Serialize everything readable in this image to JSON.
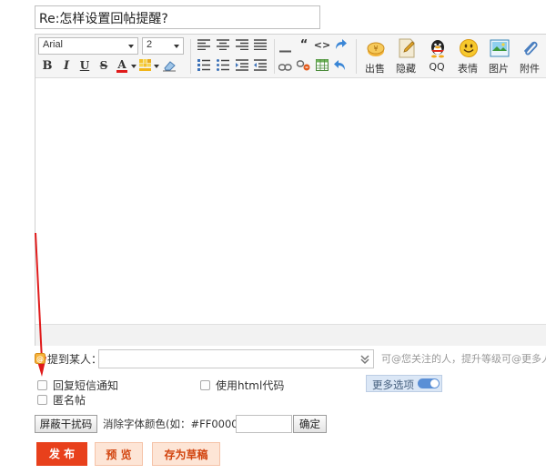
{
  "title_value": "Re:怎样设置回帖提醒?",
  "toolbar": {
    "font_family": "Arial",
    "font_size": "2",
    "bold": "B",
    "italic": "I",
    "underline": "U",
    "strike": "S",
    "text_color_glyph": "A",
    "quote_glyph": "“",
    "code_glyph": "<>",
    "buttons": [
      {
        "label": "出售"
      },
      {
        "label": "隐藏"
      },
      {
        "label": "QQ"
      },
      {
        "label": "表情"
      },
      {
        "label": "图片"
      },
      {
        "label": "附件"
      }
    ]
  },
  "mention": {
    "label": "提到某人：",
    "hint": "可@您关注的人，提升等级可@更多人"
  },
  "options": {
    "reply_notify": "回复短信通知",
    "use_html": "使用html代码",
    "anonymous": "匿名帖",
    "more_options": "更多选项"
  },
  "anti_spam": {
    "button": "屏蔽干扰码",
    "color_label": "消除字体颜色(如：#FF0000)：",
    "color_value": "",
    "confirm": "确定"
  },
  "actions": {
    "publish": "发 布",
    "preview": "预 览",
    "save_draft": "存为草稿"
  },
  "colors": {
    "publish_bg": "#e8401c",
    "secondary_bg": "#fde5d6",
    "secondary_text": "#d2440f",
    "arrow": "#e01b1b",
    "toggle": "#5a8fd6"
  }
}
